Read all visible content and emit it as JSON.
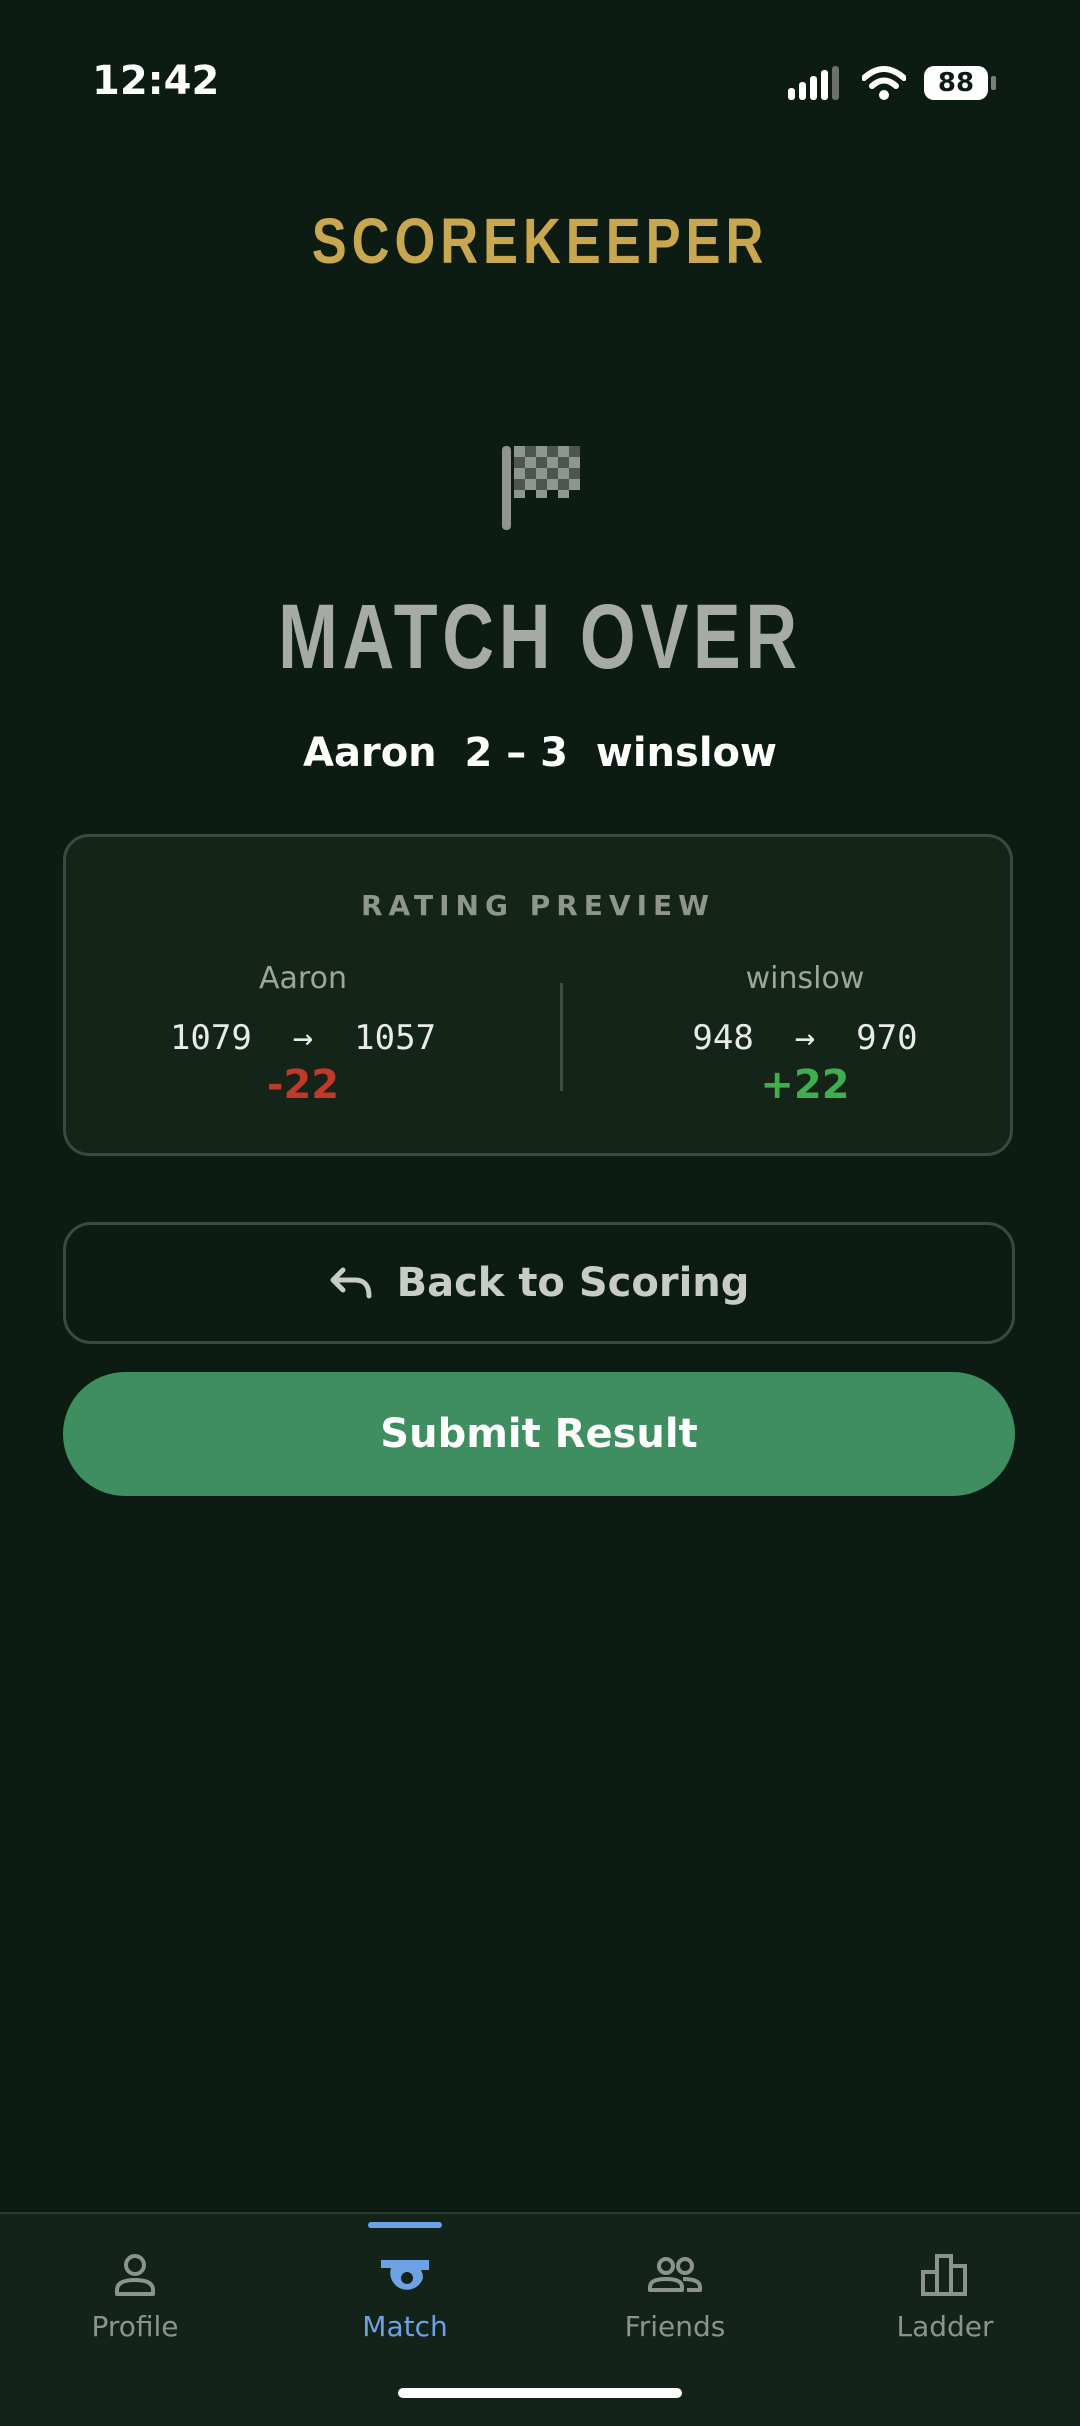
{
  "status_bar": {
    "time": "12:42",
    "battery": "88"
  },
  "header": {
    "title": "SCOREKEEPER"
  },
  "result": {
    "heading": "MATCH OVER",
    "player1": "Aaron",
    "score": "2 – 3",
    "player2": "winslow",
    "line": "Aaron  2 – 3  winslow"
  },
  "rating_preview": {
    "title": "RATING PREVIEW",
    "players": [
      {
        "name": "Aaron",
        "from": "1079",
        "to": "1057",
        "change_text": "1079  →  1057",
        "delta": "-22"
      },
      {
        "name": "winslow",
        "from": "948",
        "to": "970",
        "change_text": "948  →  970",
        "delta": "+22"
      }
    ]
  },
  "actions": {
    "back_label": "Back to Scoring",
    "submit_label": "Submit Result"
  },
  "tabs": [
    {
      "label": "Profile",
      "icon": "person-icon"
    },
    {
      "label": "Match",
      "icon": "whistle-icon",
      "active": true
    },
    {
      "label": "Friends",
      "icon": "people-icon"
    },
    {
      "label": "Ladder",
      "icon": "bar-chart-icon"
    }
  ],
  "colors": {
    "background": "#0d1c12",
    "title_gold": "#c9a750",
    "submit_green": "#3e8e5f",
    "negative": "#c0392b",
    "positive": "#3fae4f",
    "active_tab": "#6ea2e6"
  }
}
